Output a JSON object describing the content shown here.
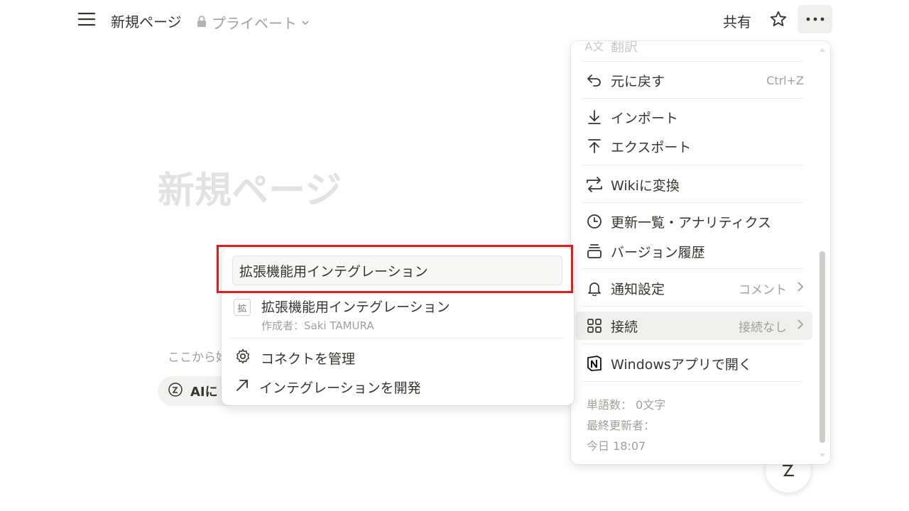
{
  "header": {
    "page_name": "新規ページ",
    "privacy_label": "プライベート",
    "share_label": "共有"
  },
  "page": {
    "title": "新規ページ",
    "hint_text": "ここから始",
    "ai_chip_label": "AIに"
  },
  "menu": {
    "partial_top_label": "翻訳",
    "undo_label": "元に戻す",
    "undo_shortcut": "Ctrl+Z",
    "import_label": "インポート",
    "export_label": "エクスポート",
    "wiki_label": "Wikiに変換",
    "analytics_label": "更新一覧・アナリティクス",
    "version_label": "バージョン履歴",
    "notify_label": "通知設定",
    "notify_value": "コメント",
    "connect_label": "接続",
    "connect_value": "接続なし",
    "windows_label": "Windowsアプリで開く",
    "word_count": "単語数： 0文字",
    "last_editor": "最終更新者：",
    "updated_time": "今日 18:07"
  },
  "connections_popup": {
    "search_value": "拡張機能用インテグレーション",
    "integration_badge": "拡",
    "integration_name": "拡張機能用インテグレーション",
    "integration_author": "作成者：Saki TAMURA",
    "manage_label": "コネクトを管理",
    "develop_label": "インテグレーションを開発"
  },
  "colors": {
    "text": "#37352f",
    "muted": "#a19f9a",
    "highlight_border": "#e31b1b",
    "hover_bg": "#efefed"
  },
  "icons": [
    "menu-icon",
    "lock-icon",
    "chevron-down-icon",
    "star-icon",
    "more-icon",
    "undo-icon",
    "import-icon",
    "export-icon",
    "wiki-icon",
    "clock-icon",
    "version-icon",
    "bell-icon",
    "grid-icon",
    "notion-icon",
    "gear-icon",
    "arrow-up-right-icon",
    "ai-icon"
  ]
}
